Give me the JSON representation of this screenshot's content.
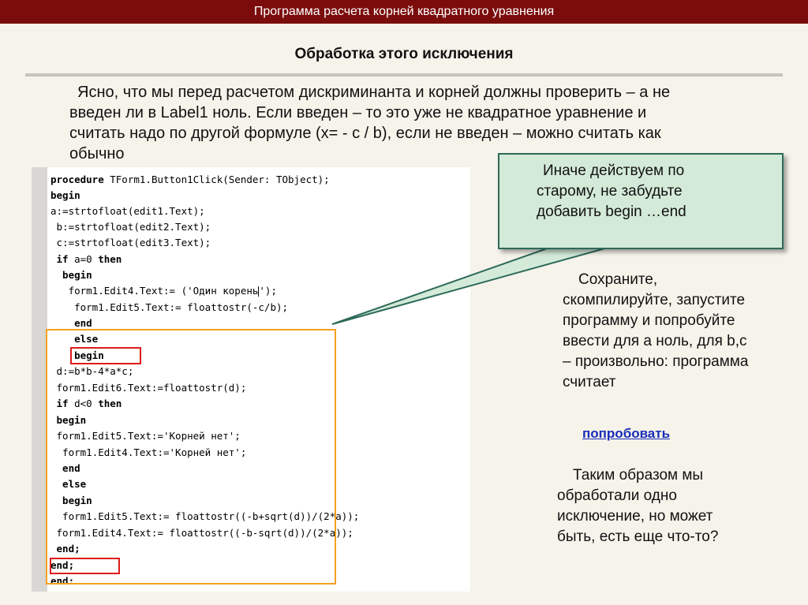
{
  "slide": {
    "title_bar": "Программа расчета корней квадратного уравнения",
    "heading": "Обработка этого исключения",
    "intro_lines": [
      "Ясно, что мы перед расчетом дискриминанта и корней должны проверить – а не",
      "введен ли в Label1 ноль. Если введен – то  это уже не квадратное уравнение и",
      "считать надо по другой формуле (x= - c / b), если не введен – можно считать как",
      "обычно"
    ],
    "code": {
      "l1a": "procedure",
      "l1b": " TForm1.Button1Click(Sender: TObject);",
      "l2": "begin",
      "l3": "a:=strtofloat(edit1.Text);",
      "l4": " b:=strtofloat(edit2.Text);",
      "l5": " c:=strtofloat(edit3.Text);",
      "l6a": " if",
      "l6b": " a=0 ",
      "l6c": "then",
      "l7": "  begin",
      "l8a": "   form1.Edit4.Text:= ('Один корень",
      "l8b": "');",
      "l9": "    form1.Edit5.Text:= floattostr(-c/b);",
      "l10": "    end",
      "l11": "    else",
      "l12": "    begin",
      "l13": " d:=b*b-4*a*c;",
      "l14": " form1.Edit6.Text:=floattostr(d);",
      "l15a": " if",
      "l15b": " d<0 ",
      "l15c": "then",
      "l16": " begin",
      "l17": " form1.Edit5.Text:='Корней нет';",
      "l18": "  form1.Edit4.Text:='Корней нет';",
      "l19": "  end",
      "l20": "  else",
      "l21": "  begin",
      "l22": "  form1.Edit5.Text:= floattostr((-b+sqrt(d))/(2*a));",
      "l23": " form1.Edit4.Text:= floattostr((-b-sqrt(d))/(2*a));",
      "l24": " end;",
      "l25": "end;",
      "l26": "end:"
    },
    "callout_lines": [
      "Иначе действуем по",
      "старому, не забудьте",
      "добавить begin …end"
    ],
    "right_lines": [
      "Сохраните,",
      "скомпилируйте, запустите",
      "программу и попробуйте",
      "ввести для а ноль,  для b,c",
      "– произвольно: программа",
      "считает"
    ],
    "try_link": "попробовать",
    "conclusion_lines": [
      "Таким образом мы",
      "обработали одно",
      "исключение, но может",
      "быть, есть еще что-то?"
    ],
    "colors": {
      "title_bar": "#7b0c0c",
      "callout_fill": "#d4ead8",
      "callout_border": "#2d6a5a",
      "highlight_orange": "#f5a020",
      "highlight_red": "#e01a1a",
      "link": "#1a2db8"
    }
  }
}
